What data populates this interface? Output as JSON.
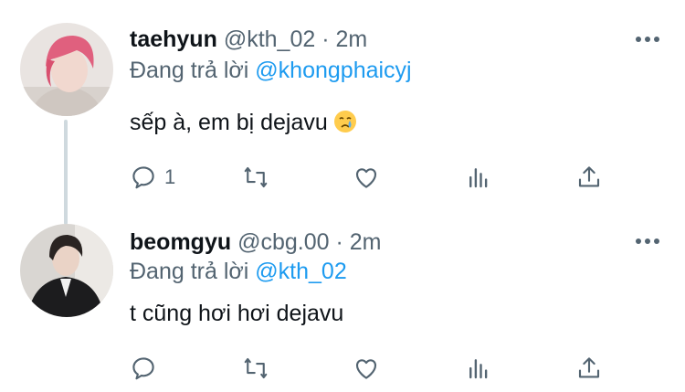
{
  "tweets": [
    {
      "display_name": "taehyun",
      "handle": "@kth_02",
      "separator": "·",
      "time": "2m",
      "replying_prefix": "Đang trả lời",
      "replying_to": "@khongphaicyj",
      "text": "sếp à, em bị dejavu",
      "emoji": "crying-face-icon",
      "reply_count": "1",
      "avatar_colors": {
        "hair": "#e0607e",
        "skin": "#f1d8cf",
        "bg": "#e9e4e1"
      }
    },
    {
      "display_name": "beomgyu",
      "handle": "@cbg.00",
      "separator": "·",
      "time": "2m",
      "replying_prefix": "Đang trả lời",
      "replying_to": "@kth_02",
      "text": "t cũng hơi hơi dejavu",
      "reply_count": "",
      "avatar_colors": {
        "hair": "#2a2422",
        "suit": "#1c1c1e",
        "bg": "#d9d6d2"
      }
    }
  ],
  "actions": [
    "reply-icon",
    "retweet-icon",
    "like-icon",
    "views-icon",
    "share-icon"
  ],
  "colors": {
    "link": "#1d9bf0",
    "secondary": "#536471",
    "text": "#0f1419",
    "thread_line": "#cfd9de"
  }
}
